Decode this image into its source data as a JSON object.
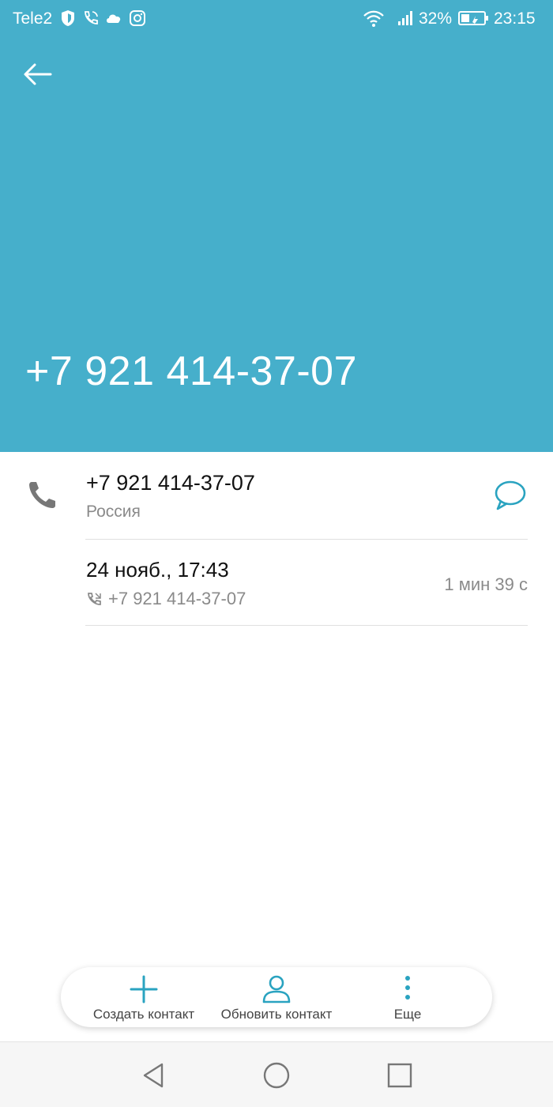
{
  "status_bar": {
    "carrier": "Tele2",
    "battery": "32%",
    "time": "23:15",
    "icons": [
      "shield-icon",
      "wifi-call-icon",
      "cloud-icon",
      "instagram-icon",
      "wifi-icon",
      "signal-icon",
      "battery-icon"
    ]
  },
  "header": {
    "title": "+7 921 414-37-07",
    "color": "#46afcb"
  },
  "contact": {
    "number": "+7 921 414-37-07",
    "country": "Россия"
  },
  "call_log": [
    {
      "date": "24 нояб., 17:43",
      "number": "+7 921 414-37-07",
      "duration": "1 мин 39 с"
    }
  ],
  "actions": {
    "create": "Создать контакт",
    "update": "Обновить контакт",
    "more": "Еще"
  },
  "accent": "#2aa3c0"
}
